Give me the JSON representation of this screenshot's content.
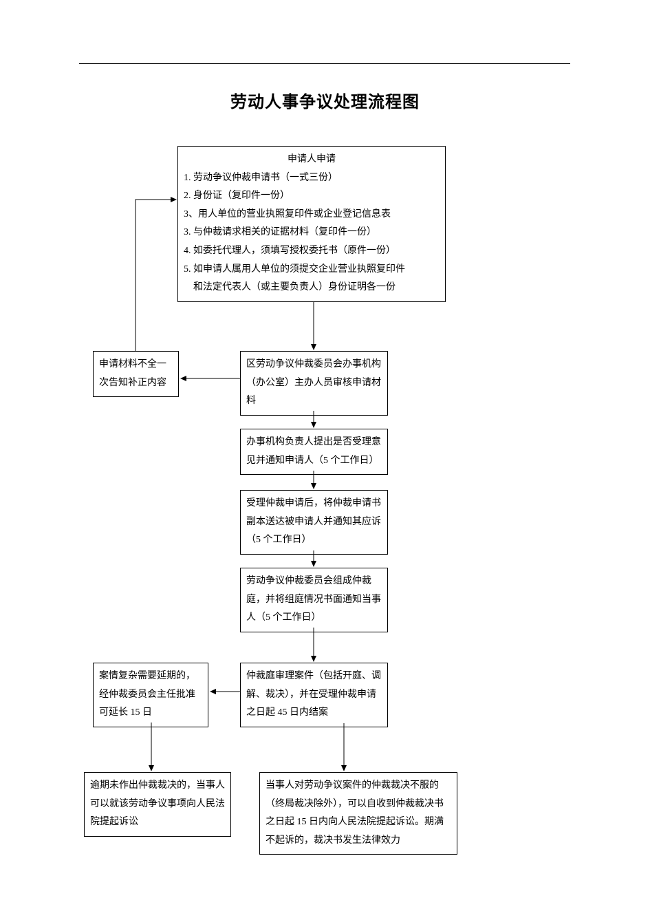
{
  "title": "劳动人事争议处理流程图",
  "nodes": {
    "apply": {
      "header": "申请人申请",
      "items": [
        "1. 劳动争议仲裁申请书（一式三份）",
        "2. 身份证（复印件一份）",
        "3、用人单位的营业执照复印件或企业登记信息表",
        "3. 与仲裁请求相关的证据材料（复印件一份）",
        "4. 如委托代理人，须填写授权委托书（原件一份）",
        "5. 如申请人属用人单位的须提交企业营业执照复印件",
        "　和法定代表人（或主要负责人）身份证明各一份"
      ]
    },
    "supplement": "申请材料不全一次告知补正内容",
    "review": "区劳动争议仲裁委员会办事机构（办公室）主办人员审核申请材料",
    "accept_opinion": "办事机构负责人提出是否受理意见并通知申请人（5 个工作日）",
    "serve_copy": "受理仲裁申请后，将仲裁申请书副本送达被申请人并通知其应诉（5 个工作日）",
    "tribunal": "劳动争议仲裁委员会组成仲裁庭，并将组庭情况书面通知当事人（5 个工作日）",
    "extend": "案情复杂需要延期的，经仲裁委员会主任批准可延长 15 日",
    "hearing": "仲裁庭审理案件（包括开庭、调解、裁决），并在受理仲裁申请之日起 45 日内结案",
    "overdue": "逾期未作出仲裁裁决的，当事人可以就该劳动争议事项向人民法院提起诉讼",
    "disagree": "当事人对劳动争议案件的仲裁裁决不服的（终局裁决除外），可以自收到仲裁裁决书之日起 15 日内向人民法院提起诉讼。期满不起诉的，裁决书发生法律效力"
  }
}
